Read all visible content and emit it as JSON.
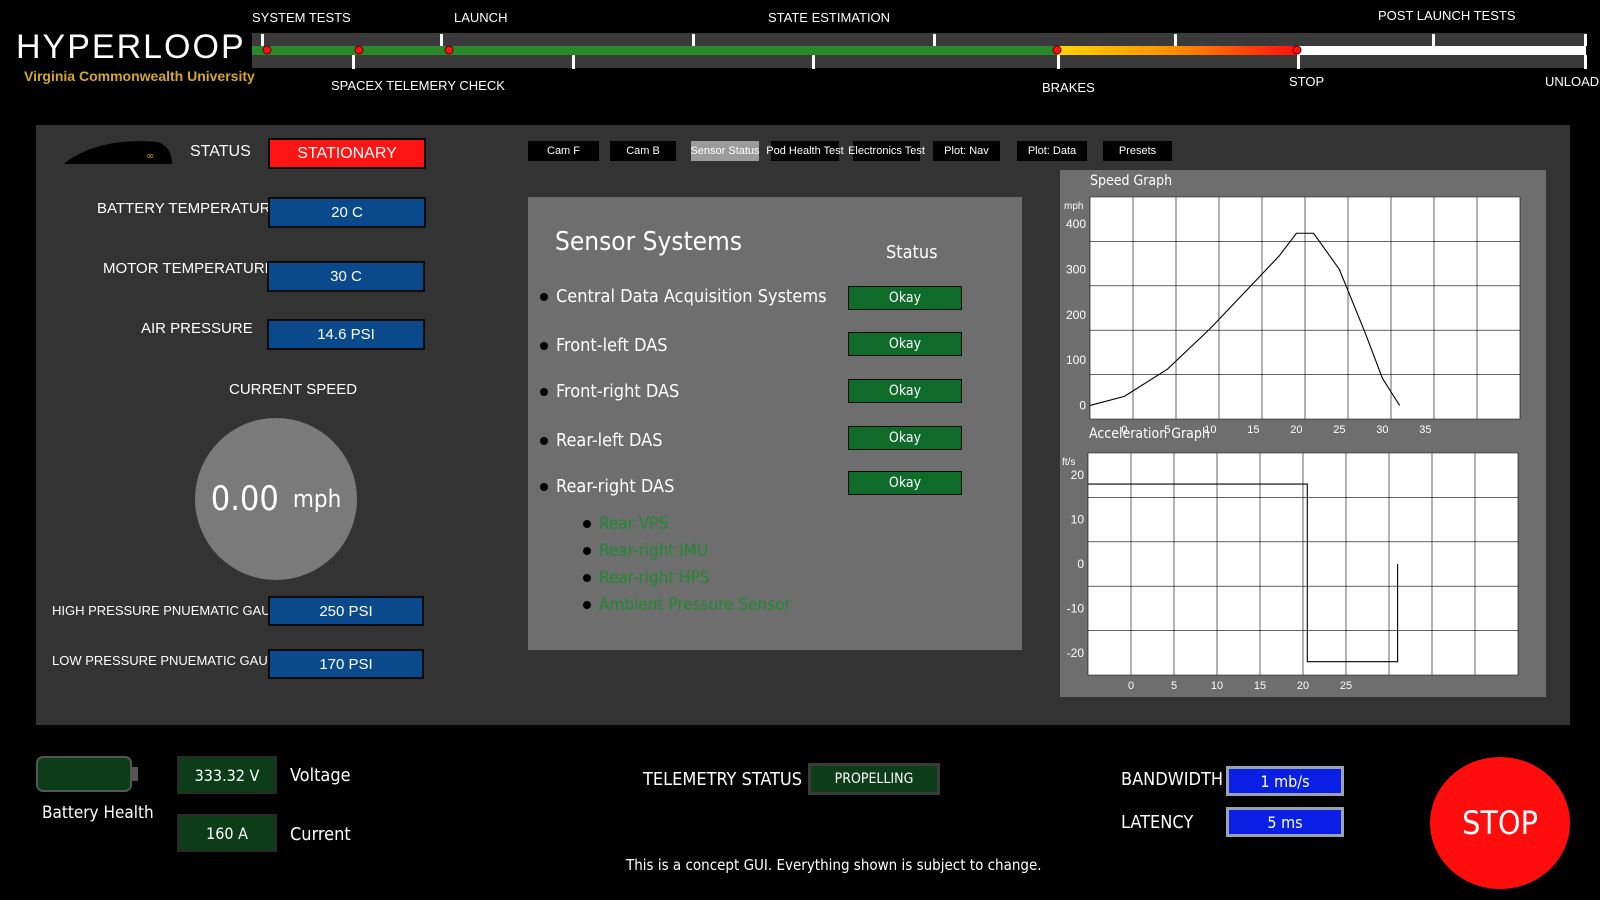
{
  "header": {
    "logo_title": "HYPERLOOP",
    "logo_subtitle": "Virginia Commonwealth University",
    "timeline": {
      "top_labels": [
        "SYSTEM TESTS",
        "LAUNCH",
        "STATE ESTIMATION",
        "POST LAUNCH TESTS"
      ],
      "bottom_labels": [
        "SPACEX TELEMERY CHECK",
        "BRAKES",
        "STOP",
        "UNLOAD"
      ]
    }
  },
  "left_panel": {
    "status_label": "STATUS",
    "status_value": "STATIONARY",
    "battery_temp_label": "BATTERY TEMPERATURE",
    "battery_temp_value": "20 C",
    "motor_temp_label": "MOTOR TEMPERATURE",
    "motor_temp_value": "30 C",
    "air_pressure_label": "AIR PRESSURE",
    "air_pressure_value": "14.6 PSI",
    "current_speed_label": "CURRENT SPEED",
    "speed_value": "0.00",
    "speed_unit": "mph",
    "hp_gauge_label": "HIGH PRESSURE PNUEMATIC GAUGE",
    "hp_gauge_value": "250 PSI",
    "lp_gauge_label": "LOW PRESSURE PNUEMATIC GAUGE",
    "lp_gauge_value": "170 PSI"
  },
  "tabs": [
    "Cam F",
    "Cam B",
    "Sensor Status",
    "Pod Health Test",
    "Electronics Test",
    "Plot: Nav",
    "Plot: Data",
    "Presets"
  ],
  "active_tab": "Sensor Status",
  "sensor_panel": {
    "title": "Sensor Systems",
    "status_header": "Status",
    "systems": [
      {
        "name": "Central Data Acquisition Systems",
        "status": "Okay"
      },
      {
        "name": "Front-left DAS",
        "status": "Okay"
      },
      {
        "name": "Front-right DAS",
        "status": "Okay"
      },
      {
        "name": "Rear-left DAS",
        "status": "Okay"
      },
      {
        "name": "Rear-right DAS",
        "status": "Okay"
      }
    ],
    "subsystems": [
      "Rear VPS",
      "Rear-right IMU",
      "Rear-right HPS",
      "Ambient Pressure Sensor"
    ]
  },
  "chart_data": [
    {
      "type": "line",
      "title": "Speed Graph",
      "ylabel": "mph",
      "xlabel": "",
      "x_ticks": [
        0,
        5,
        10,
        15,
        20,
        25,
        30,
        35
      ],
      "y_ticks": [
        0,
        100,
        200,
        300,
        400
      ],
      "xlim": [
        -4,
        46
      ],
      "ylim": [
        -30,
        460
      ],
      "grid": true,
      "series": [
        {
          "x": [
            -4,
            0,
            5,
            10,
            15,
            18,
            20,
            22,
            25,
            28,
            30,
            32
          ],
          "y": [
            0,
            20,
            80,
            170,
            270,
            330,
            380,
            380,
            300,
            160,
            60,
            0
          ]
        }
      ]
    },
    {
      "type": "line",
      "title": "Acceleration Graph",
      "ylabel": "ft/s",
      "xlabel": "",
      "x_ticks": [
        0,
        5,
        10,
        15,
        20,
        25
      ],
      "y_ticks": [
        20,
        10,
        0,
        -10,
        -20
      ],
      "xlim": [
        -5,
        45
      ],
      "ylim": [
        -25,
        25
      ],
      "grid": true,
      "series": [
        {
          "x": [
            -5,
            20.5,
            20.5,
            31,
            31
          ],
          "y": [
            18,
            18,
            -22,
            -22,
            0
          ]
        }
      ]
    }
  ],
  "bottom": {
    "battery_health_label": "Battery Health",
    "voltage_value": "333.32 V",
    "voltage_label": "Voltage",
    "current_value": "160 A",
    "current_label": "Current",
    "telemetry_label": "TELEMETRY STATUS",
    "telemetry_value": "PROPELLING",
    "bandwidth_label": "BANDWIDTH",
    "bandwidth_value": "1 mb/s",
    "latency_label": "LATENCY",
    "latency_value": "5 ms",
    "stop_label": "STOP",
    "footer_note": "This is a concept GUI. Everything shown is subject to change."
  },
  "colors": {
    "status_red": "#ff1414",
    "value_blue": "#0a4a8c",
    "ok_green": "#0f6b2a",
    "timeline_green": "#2a8a2a",
    "logo_gold": "#d4a72c"
  }
}
